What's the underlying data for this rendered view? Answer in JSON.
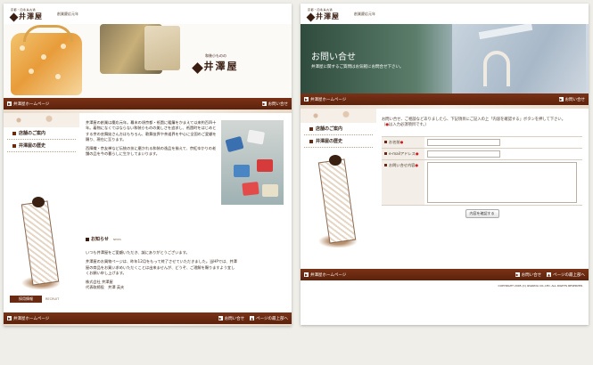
{
  "brand": {
    "sub": "京都・四条烏丸通",
    "name": "井澤屋",
    "since": "創業慶応元年",
    "tag_line": "和装小ものの"
  },
  "nav": {
    "home": "井澤屋ホームページ",
    "contact": "お問い合せ",
    "top": "ページの最上部へ"
  },
  "left": {
    "sidebar": [
      "店舗のご案内",
      "井澤屋の歴史"
    ],
    "intro_para": "井澤屋の創業は慶応元年。幕末の頃京都・祇園に暖簾をかまえて以来約百四十年。着物になくてはならない和装小ものの美しさを追求し、祇園町をはじめとする京の芸舞妓さん方はもちろん、歌舞伎界や茶道界を中心に全国のご愛顧を賜り、現在に至ります。",
    "intro_para2": "西陣織・京友禅など伝統の技に磨かれる和装の逸品を揃えて、京紅ゆかりの老舗の品を今の暮らしに生かしてまいります。",
    "news_title": "お知らせ",
    "news_en": "NEWS",
    "news_body1": "いつも井澤屋をご愛顧いただき、誠にありがとうございます。",
    "news_body2": "井澤屋のお買物ページは、昨年12月をもって終了させていただきました。当HPでは、井澤屋の商品をお買い求めいただくことは出来ませんが、どうぞ、ご理解を賜りますよう宜しくお願い申し上げます。",
    "company": "株式会社 井澤屋",
    "ceo": "代表取締役　井澤 英夫",
    "recruit_btn": "採用情報",
    "recruit_en": "RECRUIT"
  },
  "right": {
    "hero_title": "お問い合せ",
    "hero_sub": "井澤屋に関するご質問はお気軽にお問合せ下さい。",
    "sidebar": [
      "店舗のご案内",
      "井澤屋の歴史"
    ],
    "intro": "お問い合せ、ご相談などありましたら、下記項目にご記入の上「内容を確認する」ボタンを押して下さい。",
    "required_note": "（",
    "required_mark": "●",
    "required_text": "は入力必須項目です。）",
    "form": {
      "name_label": "お名前",
      "email_label": "e-mailアドレス",
      "message_label": "お問い合せ内容",
      "submit": "内容を確認する"
    },
    "copyright": "COPYRIGHT 2005 (C) IZAWAYA CO.,LTD. ALL RIGHTS RESERVED."
  },
  "colors": {
    "accent": "#6a2a12",
    "required": "#cc2222"
  }
}
